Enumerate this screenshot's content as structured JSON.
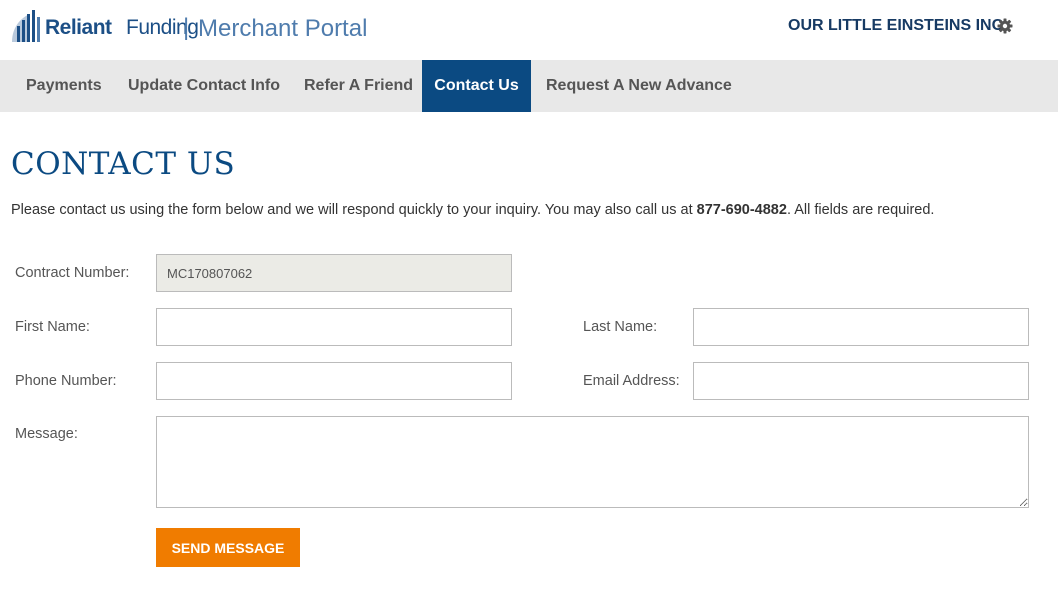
{
  "header": {
    "brand_reliant": "Reliant",
    "brand_funding": "Funding",
    "separator": "|",
    "portal_name": "Merchant Portal",
    "account_name": "OUR LITTLE EINSTEINS INC",
    "logo_icon": "building-logo-icon",
    "settings_icon": "gear-icon",
    "brand_color": "#1c4f86"
  },
  "nav": {
    "items": [
      {
        "label": "Payments",
        "active": false
      },
      {
        "label": "Update Contact Info",
        "active": false
      },
      {
        "label": "Refer A Friend",
        "active": false
      },
      {
        "label": "Contact Us",
        "active": true
      },
      {
        "label": "Request A New Advance",
        "active": false
      }
    ],
    "active_color": "#0b4a82"
  },
  "page": {
    "title": "CONTACT US",
    "intro_before": "Please contact us using the form below and we will respond quickly to your inquiry. You may also call us at ",
    "phone": "877-690-4882",
    "intro_after": ". All fields are required."
  },
  "form": {
    "contract_number": {
      "label": "Contract Number:",
      "value": "MC170807062"
    },
    "first_name": {
      "label": "First Name:",
      "value": ""
    },
    "last_name": {
      "label": "Last Name:",
      "value": ""
    },
    "phone_number": {
      "label": "Phone Number:",
      "value": ""
    },
    "email_address": {
      "label": "Email Address:",
      "value": ""
    },
    "message": {
      "label": "Message:",
      "value": ""
    },
    "submit_label": "SEND MESSAGE",
    "submit_color": "#f07c00"
  }
}
